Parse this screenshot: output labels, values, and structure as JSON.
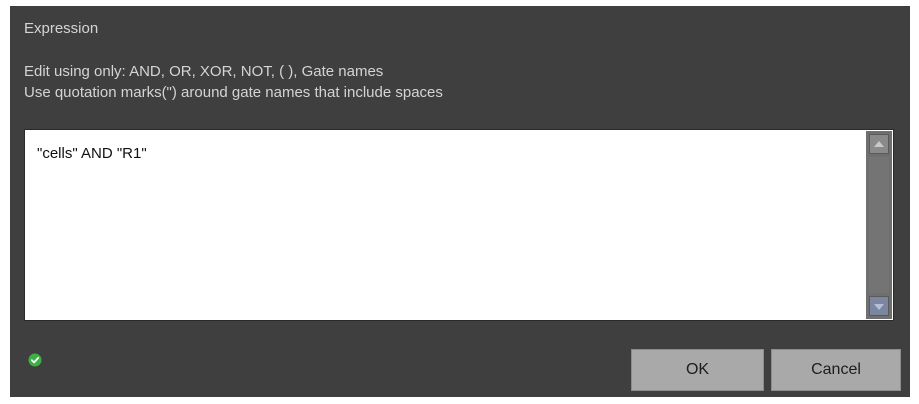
{
  "dialog": {
    "title": "Expression",
    "instructions": [
      "Edit using only: AND, OR, XOR, NOT, (  ), Gate names",
      "Use quotation marks(\") around gate names that include spaces"
    ],
    "expression_value": "\"cells\" AND \"R1\"",
    "status_icon": "check-circle-icon",
    "status_color": "#3cb043",
    "buttons": {
      "ok_label": "OK",
      "cancel_label": "Cancel"
    }
  }
}
